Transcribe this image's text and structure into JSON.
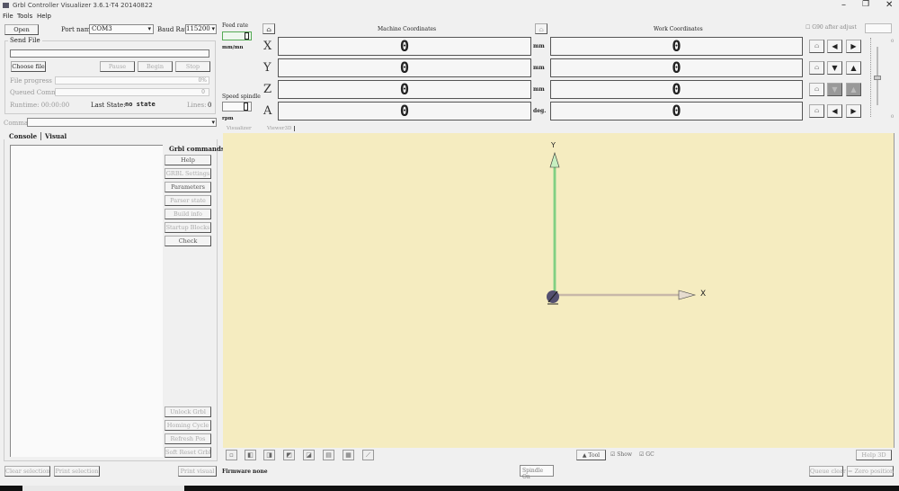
{
  "window": {
    "title": "Grbl Controller Visualizer 3.6.1-T4  20140822"
  },
  "menu": [
    "File",
    "Tools",
    "Help"
  ],
  "connection": {
    "open_label": "Open",
    "port_label": "Port name",
    "port_value": "COM3",
    "baud_label": "Baud Rate",
    "baud_value": "115200"
  },
  "send_file": {
    "group_label": "Send File",
    "path_value": "",
    "choose_label": "Choose file",
    "pause_label": "Pause",
    "begin_label": "Begin",
    "stop_label": "Stop",
    "progress_label": "File progress",
    "progress_value": "0%",
    "progress_fraction": 0,
    "queued_label": "Queued Commands",
    "queued_value": "0",
    "runtime_label": "Runtime: 00:00:00",
    "last_state_label": "Last State:",
    "last_state_value": "no state",
    "lines_label": "Lines:",
    "lines_value": "0"
  },
  "command": {
    "label": "Command",
    "value": ""
  },
  "tabs": {
    "console": "Console",
    "visual": "Visual"
  },
  "grbl": {
    "title": "Grbl commands",
    "buttons": [
      "Help",
      "GRBL Settings",
      "Parameters",
      "Parser state",
      "Build info",
      "Startup Blocks",
      "Check"
    ],
    "bottom_buttons": [
      "Unlock Grbl",
      "Homing Cycle",
      "Refresh Pos",
      "Soft Reset Grbl"
    ]
  },
  "feed": {
    "label": "Feed rate",
    "unit": "mm/mn",
    "spindle_label": "Speed spindle",
    "spindle_unit": "rpm"
  },
  "coords": {
    "machine_title": "Machine Coordinates",
    "work_title": "Work Coordinates",
    "axes": [
      {
        "name": "X",
        "machine": "0",
        "work": "0",
        "unit": "mm"
      },
      {
        "name": "Y",
        "machine": "0",
        "work": "0",
        "unit": "mm"
      },
      {
        "name": "Z",
        "machine": "0",
        "work": "0",
        "unit": "mm"
      },
      {
        "name": "A",
        "machine": "0",
        "work": "0",
        "unit": "deg."
      }
    ],
    "g90_label": "G90 after adjust",
    "g90_checked": false,
    "slider_max": "0",
    "slider_min": "0"
  },
  "viewer_tabs": {
    "visualizer": "Visualizer",
    "viewer3d": "Viewer3D"
  },
  "viewer": {
    "background": "#f5ecc0",
    "x_label": "X",
    "y_label": "Y"
  },
  "viewer_toolbar": {
    "tool_label": "Tool",
    "show_label": "Show",
    "show_checked": true,
    "gc_label": "GC",
    "gc_checked": true,
    "help_label": "Help 3D"
  },
  "bottom": {
    "clear_label": "Clear selection",
    "print_sel_label": "Print selection",
    "print_visual_label": "Print visual",
    "firmware_label": "Firmware :",
    "firmware_value": "none",
    "spindle_label": "Spindle On",
    "queue_clear_label": "Queue clear",
    "zero_label": "= Zero position"
  }
}
